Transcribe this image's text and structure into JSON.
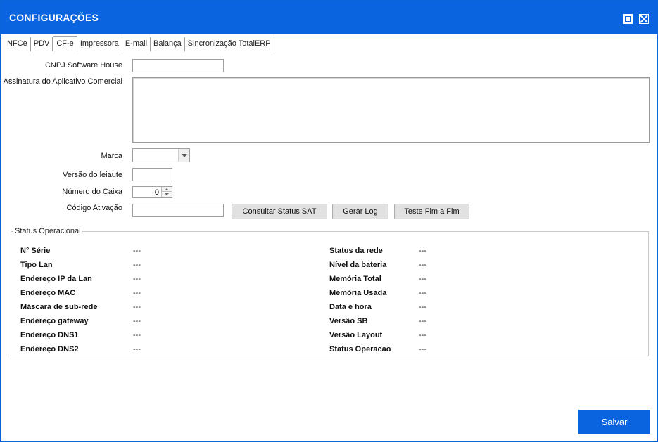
{
  "window": {
    "title": "CONFIGURAÇÕES"
  },
  "tabs": [
    {
      "label": "NFCe"
    },
    {
      "label": "PDV"
    },
    {
      "label": "CF-e"
    },
    {
      "label": "Impressora"
    },
    {
      "label": "E-mail"
    },
    {
      "label": "Balança"
    },
    {
      "label": "Sincronização TotalERP"
    }
  ],
  "active_tab": "CF-e",
  "form": {
    "cnpj_label": "CNPJ Software House",
    "cnpj_value": "",
    "assinatura_label": "Assinatura do Aplicativo Comercial",
    "assinatura_value": "",
    "marca_label": "Marca",
    "marca_value": "",
    "versao_label": "Versão do leiaute",
    "versao_value": "",
    "caixa_label": "Número do Caixa",
    "caixa_value": "0",
    "codigo_label": "Código Ativação",
    "codigo_value": ""
  },
  "buttons": {
    "consultar": "Consultar Status SAT",
    "gerar_log": "Gerar Log",
    "teste": "Teste Fim a Fim",
    "salvar": "Salvar"
  },
  "status": {
    "title": "Status Operacional",
    "left": [
      {
        "label": "N° Série",
        "value": "---"
      },
      {
        "label": "Tipo Lan",
        "value": "---"
      },
      {
        "label": "Endereço IP da Lan",
        "value": "---"
      },
      {
        "label": "Endereço MAC",
        "value": "---"
      },
      {
        "label": "Máscara de sub-rede",
        "value": "---"
      },
      {
        "label": "Endereço gateway",
        "value": "---"
      },
      {
        "label": "Endereço DNS1",
        "value": "---"
      },
      {
        "label": "Endereço DNS2",
        "value": "---"
      }
    ],
    "right": [
      {
        "label": "Status da rede",
        "value": "---"
      },
      {
        "label": "Nível da bateria",
        "value": "---"
      },
      {
        "label": "Memória Total",
        "value": "---"
      },
      {
        "label": "Memória Usada",
        "value": "---"
      },
      {
        "label": "Data e hora",
        "value": "---"
      },
      {
        "label": "Versão SB",
        "value": "---"
      },
      {
        "label": "Versão Layout",
        "value": "---"
      },
      {
        "label": "Status Operacao",
        "value": "---"
      }
    ]
  },
  "colors": {
    "accent": "#0a64e0"
  }
}
